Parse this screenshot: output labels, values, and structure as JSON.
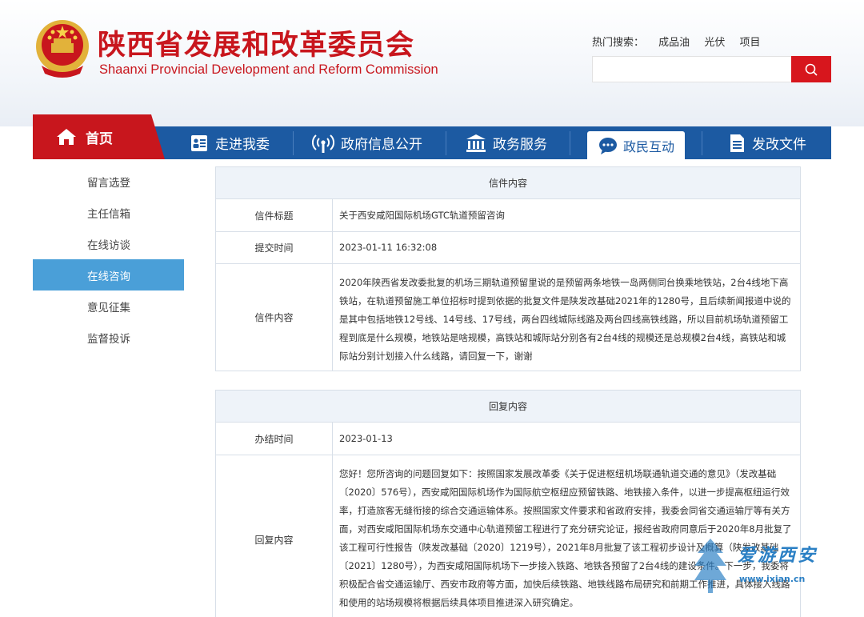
{
  "header": {
    "title_cn": "陕西省发展和改革委员会",
    "title_en": "Shaanxi Provincial Development and Reform Commission",
    "hot_search_label": "热门搜索：",
    "hot_search_terms": [
      "成品油",
      "光伏",
      "项目"
    ],
    "search_placeholder": "",
    "brand_color": "#c8161d",
    "emblem_icon": "national-emblem-icon"
  },
  "nav": {
    "home": "首页",
    "items": [
      {
        "label": "走进我委",
        "icon": "profile-card-icon"
      },
      {
        "label": "政府信息公开",
        "icon": "broadcast-icon"
      },
      {
        "label": "政务服务",
        "icon": "government-building-icon"
      },
      {
        "label": "政民互动",
        "icon": "chat-bubble-icon"
      },
      {
        "label": "发改文件",
        "icon": "document-icon"
      }
    ],
    "active_index": 3,
    "nav_color": "#1c5aa2"
  },
  "sidebar": {
    "items": [
      "留言选登",
      "主任信箱",
      "在线访谈",
      "在线咨询",
      "意见征集",
      "监督投诉"
    ],
    "active_index": 3,
    "active_color": "#4a9fd8"
  },
  "letter": {
    "header": "信件内容",
    "title_label": "信件标题",
    "title_value": "关于西安咸阳国际机场GTC轨道预留咨询",
    "time_label": "提交时间",
    "time_value": "2023-01-11 16:32:08",
    "content_label": "信件内容",
    "content_value": "2020年陕西省发改委批复的机场三期轨道预留里说的是预留两条地铁一岛两侧同台换乘地铁站，2台4线地下高铁站，在轨道预留施工单位招标时提到依据的批复文件是陕发改基础2021年的1280号，且后续新闻报道中说的是其中包括地铁12号线、14号线、17号线，两台四线城际线路及两台四线高铁线路，所以目前机场轨道预留工程到底是什么规模，地铁站是啥规模，高铁站和城际站分别各有2台4线的规模还是总规模2台4线，高铁站和城际站分别计划接入什么线路，请回复一下，谢谢"
  },
  "reply": {
    "header": "回复内容",
    "date_label": "办结时间",
    "date_value": "2023-01-13",
    "content_label": "回复内容",
    "content_value": "您好！您所咨询的问题回复如下：按照国家发展改革委《关于促进枢纽机场联通轨道交通的意见》（发改基础〔2020〕576号），西安咸阳国际机场作为国际航空枢纽应预留铁路、地铁接入条件，以进一步提高枢纽运行效率，打造旅客无缝衔接的综合交通运输体系。按照国家文件要求和省政府安排，我委会同省交通运输厅等有关方面，对西安咸阳国际机场东交通中心轨道预留工程进行了充分研究论证，报经省政府同意后于2020年8月批复了该工程可行性报告（陕发改基础〔2020〕1219号），2021年8月批复了该工程初步设计及概算（陕发改基础〔2021〕1280号），为西安咸阳国际机场下一步接入铁路、地铁各预留了2台4线的建设条件。下一步，我委将积极配合省交通运输厅、西安市政府等方面，加快后续铁路、地铁线路布局研究和前期工作推进，具体接入线路和使用的站场规模将根据后续具体项目推进深入研究确定。"
  },
  "watermark": {
    "text": "爱游西安",
    "url": "www.ixian.cn"
  }
}
